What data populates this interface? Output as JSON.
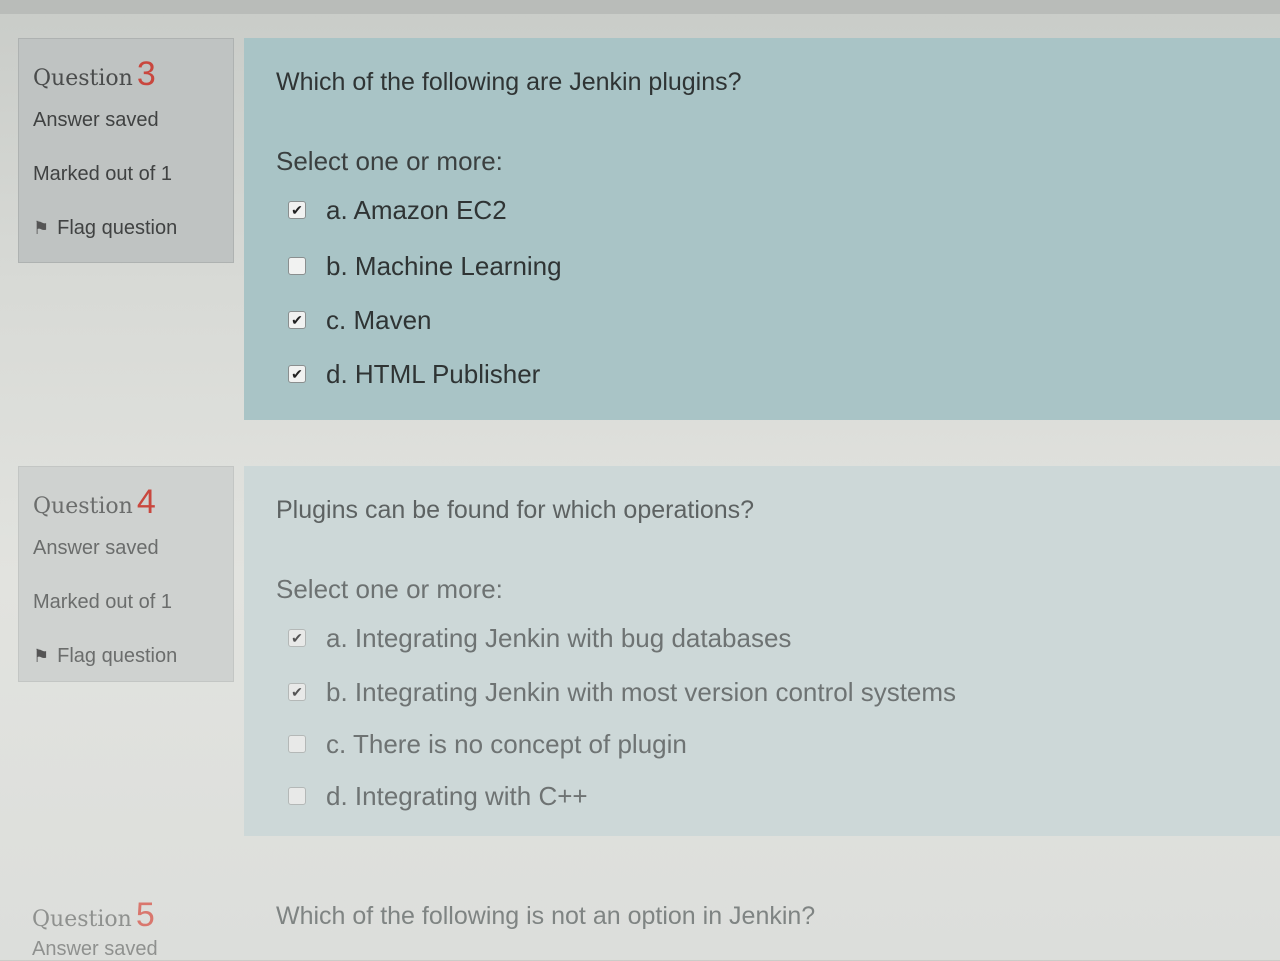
{
  "questions": [
    {
      "label": "Question",
      "number": "3",
      "state": "Answer saved",
      "grade": "Marked out of 1",
      "flag": "Flag question",
      "text": "Which of the following are Jenkin plugins?",
      "prompt": "Select one or more:",
      "options": [
        {
          "label": "a. Amazon EC2",
          "checked": true
        },
        {
          "label": "b. Machine Learning",
          "checked": false
        },
        {
          "label": "c. Maven",
          "checked": true
        },
        {
          "label": "d. HTML Publisher",
          "checked": true
        }
      ]
    },
    {
      "label": "Question",
      "number": "4",
      "state": "Answer saved",
      "grade": "Marked out of 1",
      "flag": "Flag question",
      "text": "Plugins can be found for which operations?",
      "prompt": "Select one or more:",
      "options": [
        {
          "label": "a. Integrating Jenkin with bug databases",
          "checked": true
        },
        {
          "label": "b. Integrating Jenkin with most version control systems",
          "checked": true
        },
        {
          "label": "c. There is no concept of plugin",
          "checked": false
        },
        {
          "label": "d. Integrating with C++",
          "checked": false
        }
      ]
    },
    {
      "label": "Question",
      "number": "5",
      "state": "Answer saved",
      "text": "Which of the following is not an option in Jenkin?"
    }
  ],
  "icons": {
    "flag": "flag-icon",
    "check": "checkmark-icon"
  },
  "colors": {
    "question_number": "#c9473e",
    "active_content_bg": "#a9c4c6",
    "info_bg": "#bfc3c2"
  }
}
